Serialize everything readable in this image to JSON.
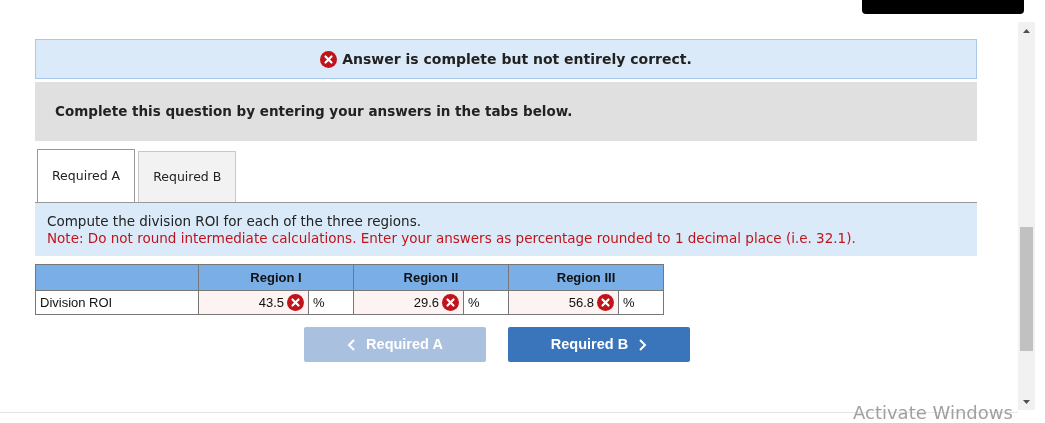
{
  "alert": {
    "kind": "error",
    "text": "Answer is complete but not entirely correct."
  },
  "instructions": "Complete this question by entering your answers in the tabs below.",
  "tabs": [
    {
      "label": "Required A",
      "selected": true
    },
    {
      "label": "Required B",
      "selected": false
    }
  ],
  "prompt": {
    "text": "Compute the division ROI for each of the three regions.",
    "note": "Note: Do not round intermediate calculations. Enter your answers as percentage rounded to 1 decimal place (i.e. 32.1)."
  },
  "table": {
    "columns": [
      "Region I",
      "Region II",
      "Region III"
    ],
    "rows": [
      {
        "label": "Division ROI",
        "cells": [
          {
            "value": "43.5",
            "correct": false,
            "unit": "%"
          },
          {
            "value": "29.6",
            "correct": false,
            "unit": "%"
          },
          {
            "value": "56.8",
            "correct": false,
            "unit": "%"
          }
        ]
      }
    ]
  },
  "nav": [
    {
      "label": "Required A",
      "kind": "prev",
      "disabled": true
    },
    {
      "label": "Required B",
      "kind": "next",
      "disabled": false
    }
  ],
  "os_overlay": "Activate Windows"
}
